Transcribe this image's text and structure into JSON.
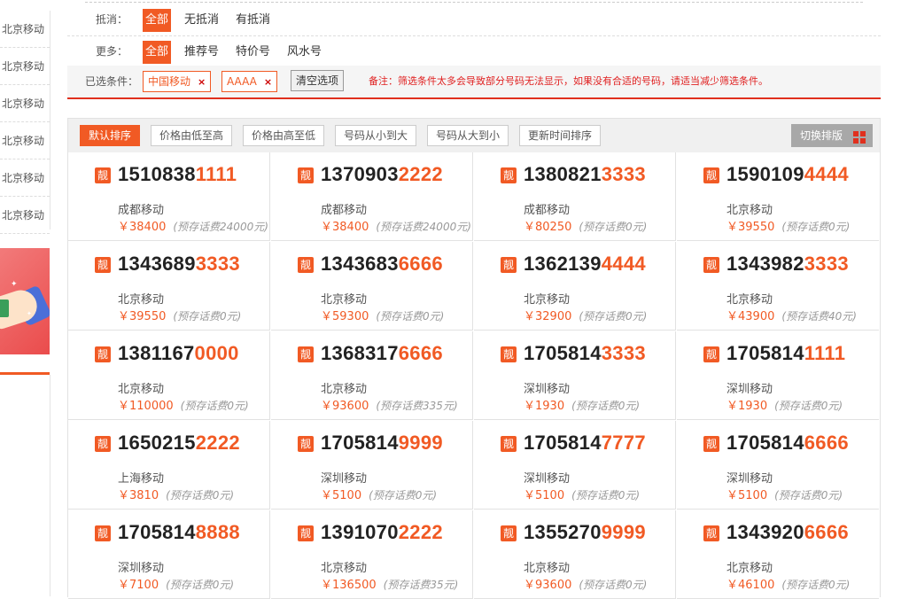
{
  "sidebar": {
    "items": [
      "北京移动",
      "北京移动",
      "北京移动",
      "北京移动",
      "北京移动",
      "北京移动"
    ]
  },
  "filters": {
    "dikou_label": "抵消：",
    "dikou_options": [
      "全部",
      "无抵消",
      "有抵消"
    ],
    "more_label": "更多：",
    "more_options": [
      "全部",
      "推荐号",
      "特价号",
      "风水号"
    ],
    "selected_label": "已选条件：",
    "chips": [
      {
        "text": "中国移动",
        "remove": "×"
      },
      {
        "text": "AAAA",
        "remove": "×"
      }
    ],
    "clear_label": "清空选项",
    "note": "备注：筛选条件太多会导致部分号码无法显示，如果没有合适的号码，请适当减少筛选条件。"
  },
  "sort": {
    "buttons": [
      "默认排序",
      "价格由低至高",
      "价格由高至低",
      "号码从小到大",
      "号码从大到小",
      "更新时间排序"
    ],
    "active_index": 0,
    "switch_label": "切换排版"
  },
  "numbers": [
    {
      "tag": "靓",
      "prefix": "1510838",
      "suffix": "1111",
      "city": "成都移动",
      "price": "￥38400",
      "deposit": "(预存话费24000元)"
    },
    {
      "tag": "靓",
      "prefix": "1370903",
      "suffix": "2222",
      "city": "成都移动",
      "price": "￥38400",
      "deposit": "(预存话费24000元)"
    },
    {
      "tag": "靓",
      "prefix": "1380821",
      "suffix": "3333",
      "city": "成都移动",
      "price": "￥80250",
      "deposit": "(预存话费0元)"
    },
    {
      "tag": "靓",
      "prefix": "1590109",
      "suffix": "4444",
      "city": "北京移动",
      "price": "￥39550",
      "deposit": "(预存话费0元)"
    },
    {
      "tag": "靓",
      "prefix": "1343689",
      "suffix": "3333",
      "city": "北京移动",
      "price": "￥39550",
      "deposit": "(预存话费0元)"
    },
    {
      "tag": "靓",
      "prefix": "1343683",
      "suffix": "6666",
      "city": "北京移动",
      "price": "￥59300",
      "deposit": "(预存话费0元)"
    },
    {
      "tag": "靓",
      "prefix": "1362139",
      "suffix": "4444",
      "city": "北京移动",
      "price": "￥32900",
      "deposit": "(预存话费0元)"
    },
    {
      "tag": "靓",
      "prefix": "1343982",
      "suffix": "3333",
      "city": "北京移动",
      "price": "￥43900",
      "deposit": "(预存话费40元)"
    },
    {
      "tag": "靓",
      "prefix": "1381167",
      "suffix": "0000",
      "city": "北京移动",
      "price": "￥110000",
      "deposit": "(预存话费0元)"
    },
    {
      "tag": "靓",
      "prefix": "1368317",
      "suffix": "6666",
      "city": "北京移动",
      "price": "￥93600",
      "deposit": "(预存话费335元)"
    },
    {
      "tag": "靓",
      "prefix": "1705814",
      "suffix": "3333",
      "city": "深圳移动",
      "price": "￥1930",
      "deposit": "(预存话费0元)"
    },
    {
      "tag": "靓",
      "prefix": "1705814",
      "suffix": "1111",
      "city": "深圳移动",
      "price": "￥1930",
      "deposit": "(预存话费0元)"
    },
    {
      "tag": "靓",
      "prefix": "1650215",
      "suffix": "2222",
      "city": "上海移动",
      "price": "￥3810",
      "deposit": "(预存话费0元)"
    },
    {
      "tag": "靓",
      "prefix": "1705814",
      "suffix": "9999",
      "city": "深圳移动",
      "price": "￥5100",
      "deposit": "(预存话费0元)"
    },
    {
      "tag": "靓",
      "prefix": "1705814",
      "suffix": "7777",
      "city": "深圳移动",
      "price": "￥5100",
      "deposit": "(预存话费0元)"
    },
    {
      "tag": "靓",
      "prefix": "1705814",
      "suffix": "6666",
      "city": "深圳移动",
      "price": "￥5100",
      "deposit": "(预存话费0元)"
    },
    {
      "tag": "靓",
      "prefix": "1705814",
      "suffix": "8888",
      "city": "深圳移动",
      "price": "￥7100",
      "deposit": "(预存话费0元)"
    },
    {
      "tag": "靓",
      "prefix": "1391070",
      "suffix": "2222",
      "city": "北京移动",
      "price": "￥136500",
      "deposit": "(预存话费35元)"
    },
    {
      "tag": "靓",
      "prefix": "1355270",
      "suffix": "9999",
      "city": "北京移动",
      "price": "￥93600",
      "deposit": "(预存话费0元)"
    },
    {
      "tag": "靓",
      "prefix": "1343920",
      "suffix": "6666",
      "city": "北京移动",
      "price": "￥46100",
      "deposit": "(预存话费0元)"
    }
  ],
  "colors": {
    "accent": "#f15a24",
    "note_red": "#e02020",
    "divider_red": "#e0301e"
  }
}
